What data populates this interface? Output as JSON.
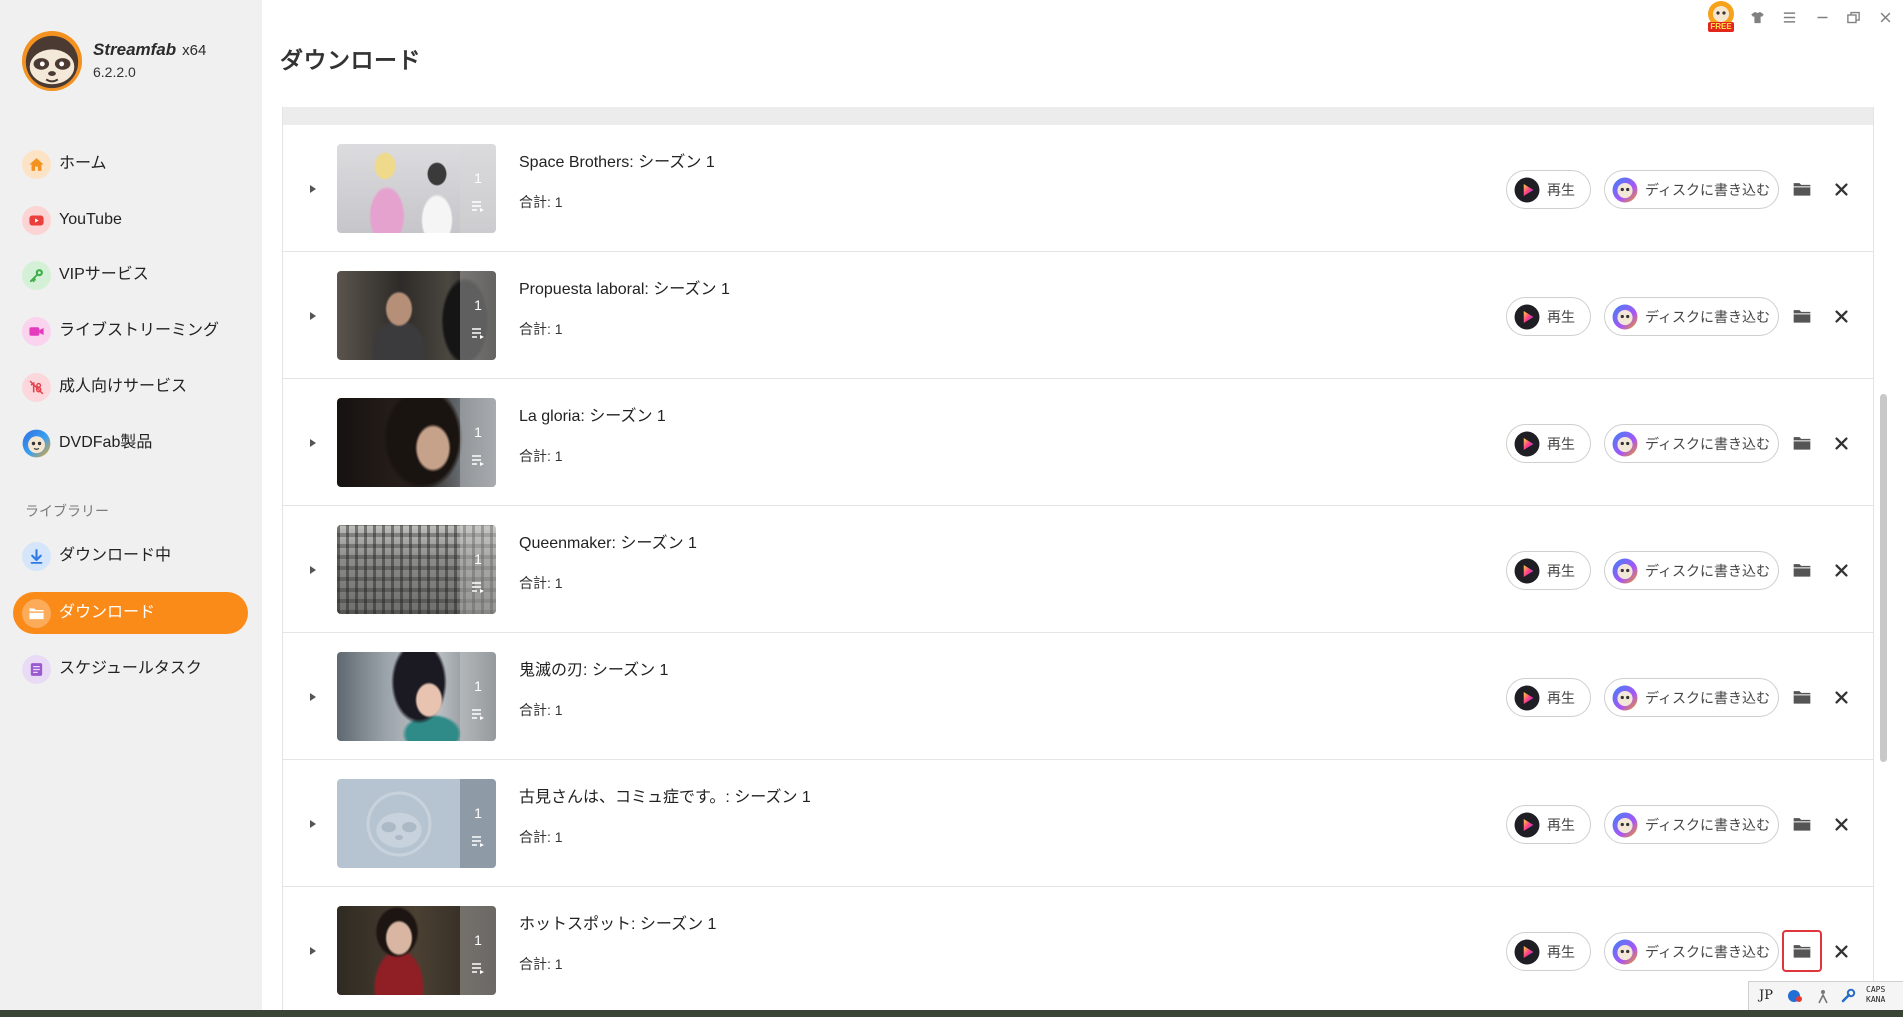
{
  "app": {
    "name": "Streamfab",
    "arch": "x64",
    "version": "6.2.2.0"
  },
  "topbar": {
    "free_badge": "FREE",
    "icons": [
      "free-offer-icon",
      "skin-shirt-icon",
      "menu-icon",
      "minimize-icon",
      "restore-icon",
      "close-icon"
    ]
  },
  "sidebar": {
    "items": [
      {
        "label": "ホーム",
        "icon": "home-icon"
      },
      {
        "label": "YouTube",
        "icon": "youtube-icon"
      },
      {
        "label": "VIPサービス",
        "icon": "key-icon"
      },
      {
        "label": "ライブストリーミング",
        "icon": "video-camera-icon"
      },
      {
        "label": "成人向けサービス",
        "icon": "adult-restricted-icon"
      },
      {
        "label": "DVDFab製品",
        "icon": "dvdfab-logo-icon"
      }
    ],
    "library_title": "ライブラリー",
    "library_items": [
      {
        "label": "ダウンロード中",
        "icon": "download-arrow-icon"
      },
      {
        "label": "ダウンロード",
        "icon": "folder-icon",
        "active": true
      },
      {
        "label": "スケジュールタスク",
        "icon": "schedule-list-icon"
      }
    ]
  },
  "page": {
    "title": "ダウンロード"
  },
  "downloads": {
    "play_label": "再生",
    "burn_label": "ディスクに書き込む",
    "items": [
      {
        "title": "Space Brothers: シーズン 1",
        "total": "合計: 1",
        "episodes": "1"
      },
      {
        "title": "Propuesta laboral: シーズン 1",
        "total": "合計: 1",
        "episodes": "1"
      },
      {
        "title": "La gloria: シーズン 1",
        "total": "合計: 1",
        "episodes": "1"
      },
      {
        "title": "Queenmaker: シーズン 1",
        "total": "合計: 1",
        "episodes": "1"
      },
      {
        "title": "鬼滅の刃: シーズン 1",
        "total": "合計: 1",
        "episodes": "1"
      },
      {
        "title": "古見さんは、コミュ症です。: シーズン 1",
        "total": "合計: 1",
        "episodes": "1"
      },
      {
        "title": "ホットスポット: シーズン 1",
        "total": "合計: 1",
        "episodes": "1"
      }
    ]
  },
  "ime_bar": {
    "language": "JP",
    "caps": "CAPS",
    "kana": "KANA"
  },
  "colors": {
    "accent": "#fb8b19",
    "sidebar_bg": "#f0f0f0",
    "highlight_box": "#e0353a"
  }
}
